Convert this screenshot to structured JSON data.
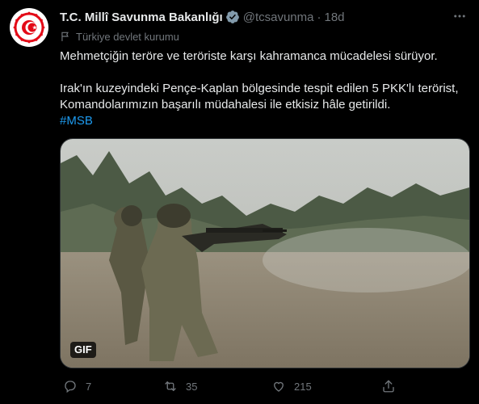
{
  "tweet": {
    "author_name": "T.C. Millî Savunma Bakanlığı",
    "handle": "@tcsavunma",
    "separator": "·",
    "time": "18d",
    "account_label": "Türkiye devlet kurumu",
    "text_line1": "Mehmetçiğin teröre ve teröriste karşı kahramanca mücadelesi sürüyor.",
    "text_line2": "Irak'ın kuzeyindeki Pençe-Kaplan bölgesinde tespit edilen 5 PKK'lı terörist, Komandolarımızın başarılı müdahalesi ile etkisiz hâle getirildi.",
    "hashtag": "#MSB",
    "media_badge": "GIF",
    "reply_count": "7",
    "retweet_count": "35",
    "like_count": "215"
  },
  "colors": {
    "background": "#000000",
    "text": "#e7e9ea",
    "muted": "#71767b",
    "accent": "#1d9bf0",
    "avatar_red": "#e30a17"
  },
  "icons": [
    "verified-icon",
    "government-flag-icon",
    "more-icon",
    "reply-icon",
    "retweet-icon",
    "like-icon",
    "share-icon"
  ]
}
